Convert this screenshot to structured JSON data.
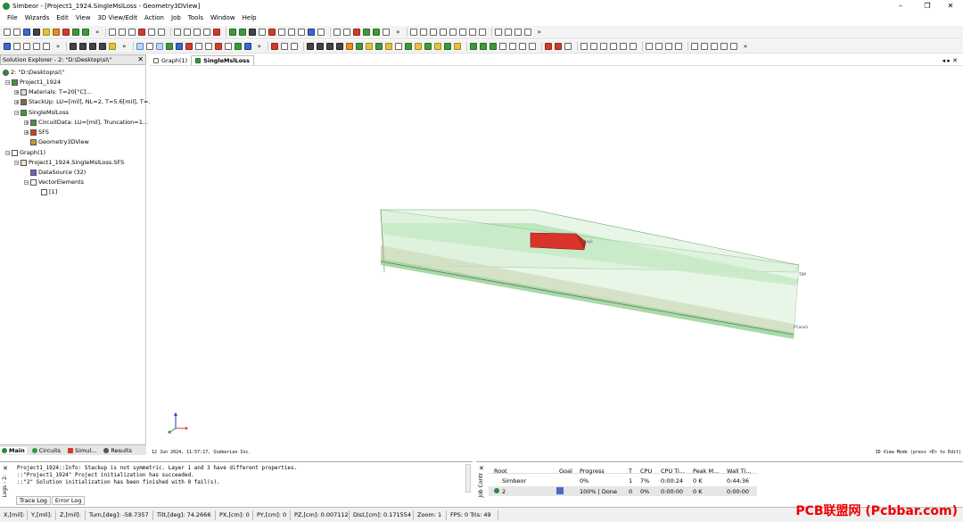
{
  "window": {
    "title": "Simbeor - [Project1_1924.SingleMslLoss - Geometry3DView]"
  },
  "menu": [
    "File",
    "Wizards",
    "Edit",
    "View",
    "3D View/Edit",
    "Action",
    "Job",
    "Tools",
    "Window",
    "Help"
  ],
  "solution_explorer": {
    "title": "Solution Explorer - 2: \"D:\\Desktop\\si\\\"",
    "close": "✕",
    "tree": [
      {
        "label": "2: \"D:\\Desktop\\si\\\"",
        "depth": 0
      },
      {
        "label": "Project1_1924",
        "depth": 1
      },
      {
        "label": "Materials: T=20[°C]...",
        "depth": 2
      },
      {
        "label": "StackUp: LU=[mil], NL=2, T=5.6[mil], T=...",
        "depth": 2
      },
      {
        "label": "SingleMslLoss",
        "depth": 2
      },
      {
        "label": "CircuitData: LU=[mil], Truncation=1...",
        "depth": 3
      },
      {
        "label": "SFS",
        "depth": 3
      },
      {
        "label": "Geometry3DView",
        "depth": 3
      },
      {
        "label": "Graph(1)",
        "depth": 1
      },
      {
        "label": "Project1_1924.SingleMslLoss.SFS",
        "depth": 2
      },
      {
        "label": "DataSource (32)",
        "depth": 3
      },
      {
        "label": "VectorElements",
        "depth": 3
      },
      {
        "label": "[1]",
        "depth": 4
      }
    ],
    "tabs": [
      "Main",
      "Circuits",
      "Simul...",
      "Results"
    ]
  },
  "doc_tabs": [
    "Graph(1)",
    "SingleMslLoss"
  ],
  "view": {
    "label_top": "TOP",
    "label_plane": "Plane1",
    "label_ring": "Ring1",
    "footer_left": "12 Jun 2024, 11:57:17, Simberian Inc.",
    "footer_right": "3D View Mode (press <E> to Edit)"
  },
  "log": {
    "lines": [
      "Project1_1924::Info: Stackup is not symmetric. Layer 1 and 3 have different properties.",
      "::\"Project1_1924\" Project initialization has succeeded.",
      "::\"2\" Solution initialization has been finished with 0 fail(s)."
    ],
    "side_label": "Logs - 2:",
    "tabs": [
      "Trace Log",
      "Error Log"
    ]
  },
  "jobs": {
    "side_label": "Job Contr",
    "headers": [
      "Root",
      "Goal",
      "Progress",
      "T",
      "CPU",
      "CPU Ti...",
      "Peak M...",
      "Wall Ti..."
    ],
    "rows": [
      {
        "root": "Simbeor",
        "goal": "",
        "progress": "0%",
        "t": "1",
        "cpu": "7%",
        "cpu_time": "0:00:24",
        "peak": "0 K",
        "wall": "0:44:36"
      },
      {
        "root": "2",
        "goal": "",
        "progress": "100% | Done",
        "t": "0",
        "cpu": "0%",
        "cpu_time": "0:00:00",
        "peak": "0 K",
        "wall": "0:00:00"
      }
    ]
  },
  "status": [
    "X,[mil]:",
    "Y,[mil]:",
    "Z,[mil]:",
    "Turn,[deg]: -58.7357",
    "Tilt,[deg]: 74.2666",
    "PX,[cm]: 0",
    "PY,[cm]: 0",
    "PZ,[cm]: 0.007112",
    "Dist,[cm]: 0.171554",
    "Zoom: 1",
    "FPS: 0 Tris: 49"
  ],
  "watermark": "PCB联盟网 (Pcbbar.com)"
}
